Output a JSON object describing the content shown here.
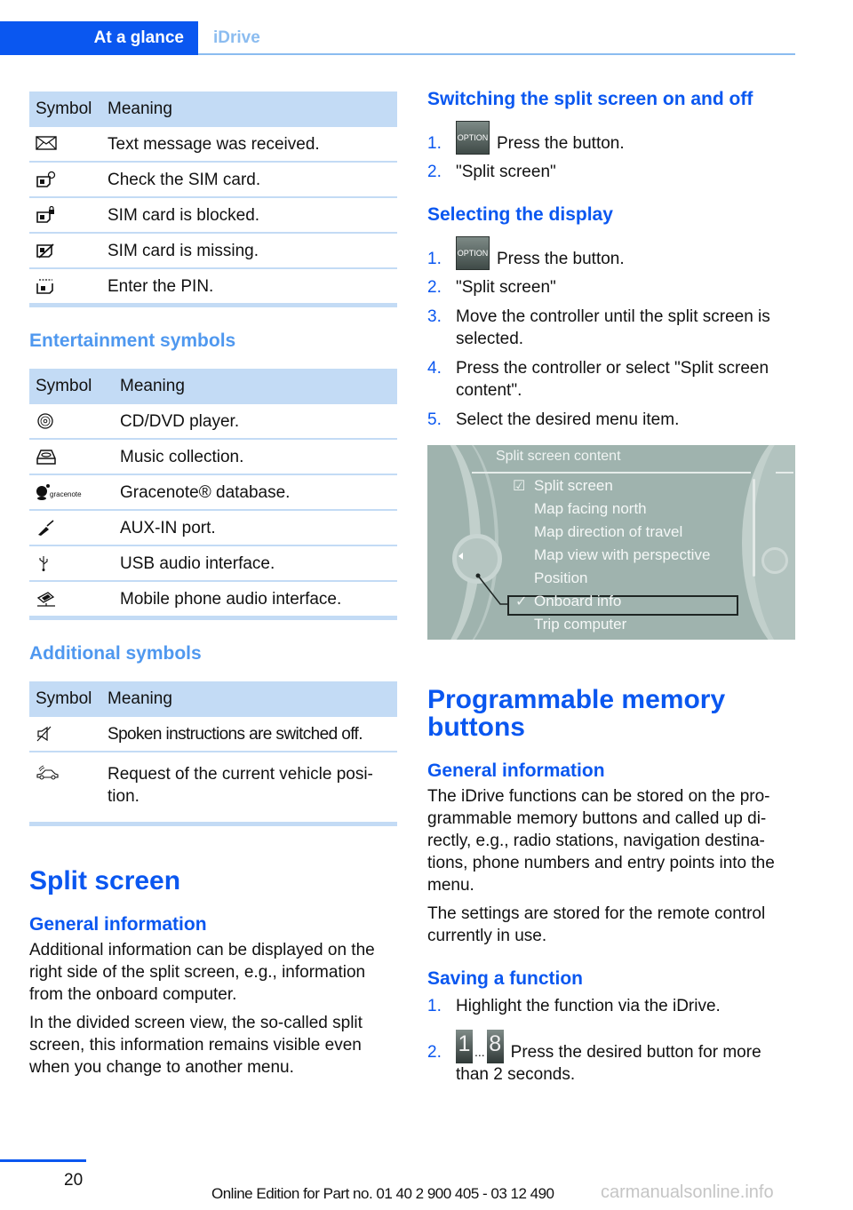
{
  "header": {
    "tabs": [
      {
        "label": "At a glance",
        "active": true
      },
      {
        "label": "iDrive",
        "active": false
      }
    ],
    "accent_color": "#0a57f0"
  },
  "tables": {
    "status": {
      "col_symbol": "Symbol",
      "col_meaning": "Meaning",
      "rows": [
        {
          "icon": "envelope-icon",
          "meaning": "Text message was received."
        },
        {
          "icon": "sim-check-icon",
          "meaning": "Check the SIM card."
        },
        {
          "icon": "sim-locked-icon",
          "meaning": "SIM card is blocked."
        },
        {
          "icon": "sim-missing-icon",
          "meaning": "SIM card is missing."
        },
        {
          "icon": "sim-pin-icon",
          "meaning": "Enter the PIN."
        }
      ]
    },
    "entertainment": {
      "heading": "Entertainment symbols",
      "col_symbol": "Symbol",
      "col_meaning": "Meaning",
      "rows": [
        {
          "icon": "cd-dvd-icon",
          "meaning": "CD/DVD player."
        },
        {
          "icon": "music-collection-icon",
          "meaning": "Music collection."
        },
        {
          "icon": "gracenote-icon",
          "icon_text": "gracenote",
          "meaning": "Gracenote® database."
        },
        {
          "icon": "aux-plug-icon",
          "meaning": "AUX-IN port."
        },
        {
          "icon": "usb-icon",
          "meaning": "USB audio interface."
        },
        {
          "icon": "mobile-phone-audio-icon",
          "meaning": "Mobile phone audio interface."
        }
      ]
    },
    "additional": {
      "heading": "Additional symbols",
      "col_symbol": "Symbol",
      "col_meaning": "Meaning",
      "rows": [
        {
          "icon": "speaker-muted-icon",
          "meaning": "Spoken instructions are switched off."
        },
        {
          "icon": "vehicle-position-icon",
          "meaning": "Request of the current vehicle posi-tion."
        }
      ]
    }
  },
  "split_screen": {
    "title": "Split screen",
    "general_heading": "General information",
    "para1": "Additional information can be displayed on the right side of the split screen, e.g., information from the onboard computer.",
    "para2": "In the divided screen view, the so-called split screen, this information remains visible even when you change to another menu.",
    "switching": {
      "heading": "Switching the split screen on and off",
      "steps": [
        {
          "num": "1.",
          "button_label": "OPTION",
          "text": "Press the button."
        },
        {
          "num": "2.",
          "text": "\"Split screen\""
        }
      ]
    },
    "selecting": {
      "heading": "Selecting the display",
      "steps": [
        {
          "num": "1.",
          "button_label": "OPTION",
          "text": "Press the button."
        },
        {
          "num": "2.",
          "text": "\"Split screen\""
        },
        {
          "num": "3.",
          "text": "Move the controller until the split screen is selected."
        },
        {
          "num": "4.",
          "text": "Press the controller or select \"Split screen content\"."
        },
        {
          "num": "5.",
          "text": "Select the desired menu item."
        }
      ]
    },
    "screen": {
      "title": "Split screen content",
      "items": [
        {
          "label": "Split screen",
          "mark": "checkbox-checked"
        },
        {
          "label": "Map facing north",
          "mark": ""
        },
        {
          "label": "Map direction of travel",
          "mark": ""
        },
        {
          "label": "Map view with perspective",
          "mark": ""
        },
        {
          "label": "Position",
          "mark": ""
        },
        {
          "label": "Onboard info",
          "mark": "check",
          "selected": true
        },
        {
          "label": "Trip computer",
          "mark": ""
        }
      ],
      "checkbox_glyph": "☑",
      "check_glyph": "✓"
    }
  },
  "memory_buttons": {
    "title": "Programmable memory buttons",
    "general_heading": "General information",
    "para1": "The iDrive functions can be stored on the pro-grammable memory buttons and called up di-rectly, e.g., radio stations, navigation destina-tions, phone numbers and entry points into the menu.",
    "para2": "The settings are stored for the remote control currently in use.",
    "saving": {
      "heading": "Saving a function",
      "steps": [
        {
          "num": "1.",
          "text": "Highlight the function via the iDrive."
        },
        {
          "num": "2.",
          "btn_first": "1",
          "ellipsis": "...",
          "btn_last": "8",
          "text": "Press the desired button for more than 2 seconds."
        }
      ]
    }
  },
  "footer": {
    "page_number": "20",
    "edition": "Online Edition for Part no. 01 40 2 900 405 - 03 12 490",
    "watermark": "carmanualsonline.info"
  }
}
